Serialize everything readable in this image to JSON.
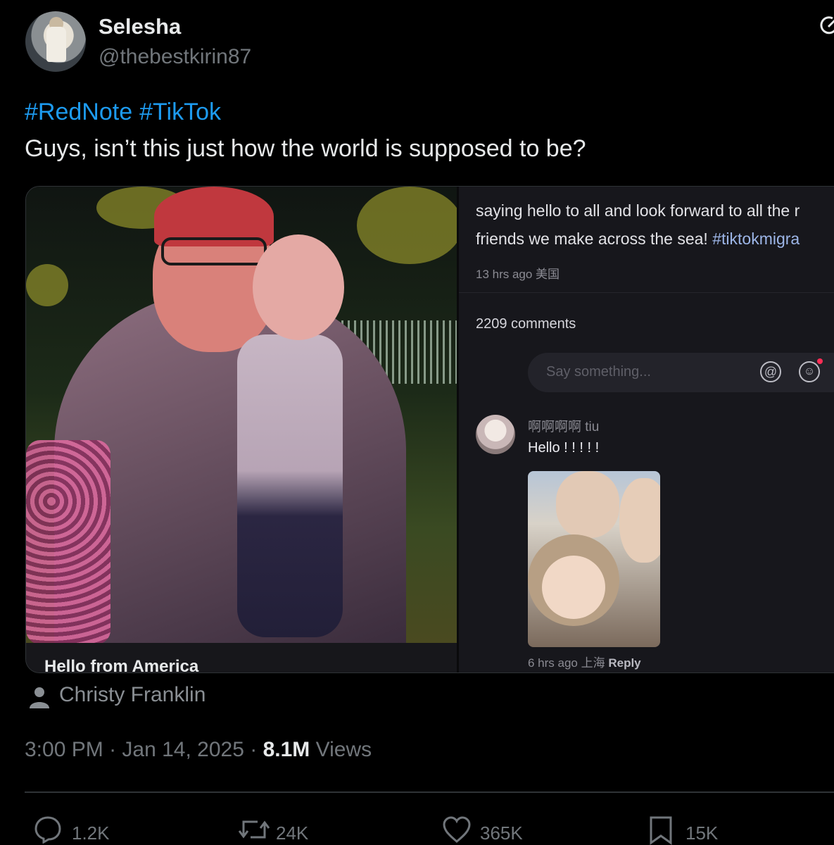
{
  "post": {
    "display_name": "Selesha",
    "handle": "@thebestkirin87",
    "hashtags": [
      "#RedNote",
      "#TikTok"
    ],
    "text": "Guys, isn’t this just how the world is supposed to be?"
  },
  "media": {
    "photo_caption": "Hello from America",
    "comments_panel": {
      "description_line1": "saying hello to all and look forward to all the r",
      "description_line2_text": "friends we make across the sea!",
      "description_line2_tag": "#tiktokmigra",
      "meta": "13 hrs ago 美国",
      "comment_count": "2209 comments",
      "input_placeholder": "Say something...",
      "comment": {
        "username": "啊啊啊啊 tiu",
        "text": "Hello ! ! ! ! !",
        "meta_time": "6 hrs ago 上海",
        "reply_label": "Reply"
      }
    }
  },
  "author_credit": "Christy Franklin",
  "timestamp": {
    "time": "3:00 PM",
    "separator": "·",
    "date": "Jan 14, 2025",
    "views_count": "8.1M",
    "views_label": "Views"
  },
  "actions": {
    "replies": "1.2K",
    "reposts": "24K",
    "likes": "365K",
    "bookmarks": "15K"
  },
  "icons": {
    "reply": "speech-bubble-icon",
    "repost": "repost-icon",
    "like": "heart-icon",
    "bookmark": "bookmark-icon",
    "author": "person-icon",
    "grok": "grok-icon"
  },
  "colors": {
    "background": "#000000",
    "link_blue": "#1d9bf0",
    "muted_gray": "#71767b",
    "text": "#e7e9ea"
  }
}
